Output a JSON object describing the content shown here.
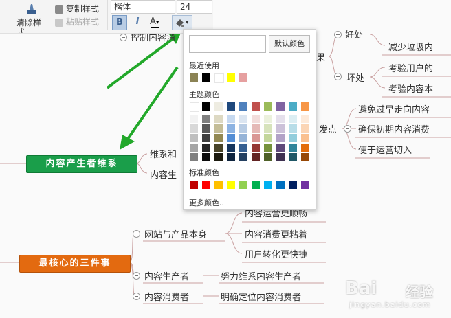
{
  "toolbar": {
    "clear_style": "清除样式",
    "copy_style": "复制样式",
    "paste_style": "粘贴样式",
    "font_family": "楷体",
    "font_size": "24",
    "bold": "B",
    "italic": "I",
    "font_color": "A",
    "dropdown_arrow": "▾"
  },
  "mindmap": {
    "truncated_top": "控制内容消",
    "pros_cons_label": "果",
    "benefit": "好处",
    "benefit_item": "减少垃圾内",
    "drawback": "坏处",
    "drawback_item1": "考验用户的",
    "drawback_item2": "考验内容本",
    "starting_point": "发点",
    "sp_item1": "避免过早走向内容",
    "sp_item2": "确保初期内容消费",
    "sp_item3": "便于运营切入",
    "main_node1": "内容产生者维系",
    "sub1": "维系和",
    "sub2": "内容生",
    "main_node2": "最核心的三件事",
    "website_product": "网站与产品本身",
    "wp_item1": "内容运营更顺畅",
    "wp_item2": "内容消费更粘着",
    "wp_item3": "用户转化更快捷",
    "producer": "内容生产者",
    "producer_item": "努力维系内容生产者",
    "consumer": "内容消费者",
    "consumer_item": "明确定位内容消费者"
  },
  "color_picker": {
    "default_button": "默认颜色",
    "recent_label": "最近使用",
    "theme_label": "主题颜色",
    "standard_label": "标准颜色",
    "more_colors": "更多颜色..",
    "recent_colors": [
      "#8b8355",
      "#000000",
      "#ffffff",
      "#ffff00",
      "#e6a0a0"
    ],
    "theme_top": [
      "#ffffff",
      "#000000",
      "#eeece1",
      "#1f497d",
      "#4f81bd",
      "#c0504d",
      "#9bbb59",
      "#8064a2",
      "#4bacc6",
      "#f79646"
    ],
    "theme_shades": [
      [
        "#f2f2f2",
        "#7f7f7f",
        "#ddd9c3",
        "#c6d9f0",
        "#dbe5f1",
        "#f2dcdb",
        "#ebf1dd",
        "#e5e0ec",
        "#dbeef3",
        "#fdeada"
      ],
      [
        "#d8d8d8",
        "#595959",
        "#c4bd97",
        "#8db3e2",
        "#b8cce4",
        "#e5b9b7",
        "#d7e3bc",
        "#ccc1d9",
        "#b7dde8",
        "#fbd5b5"
      ],
      [
        "#bfbfbf",
        "#3f3f3f",
        "#938953",
        "#548dd4",
        "#95b3d7",
        "#d99694",
        "#c3d69b",
        "#b2a2c7",
        "#92cddc",
        "#fac08f"
      ],
      [
        "#a5a5a5",
        "#262626",
        "#494429",
        "#17365d",
        "#366092",
        "#953734",
        "#76923c",
        "#5f497a",
        "#31859b",
        "#e36c09"
      ],
      [
        "#7f7f7f",
        "#0c0c0c",
        "#1d1b10",
        "#0f243e",
        "#244061",
        "#632423",
        "#4f6128",
        "#3f3151",
        "#205867",
        "#974806"
      ]
    ],
    "standard_colors": [
      "#c00000",
      "#ff0000",
      "#ffc000",
      "#ffff00",
      "#92d050",
      "#00b050",
      "#00b0f0",
      "#0070c0",
      "#002060",
      "#7030a0"
    ]
  },
  "colors": {
    "main_node1_bg": "#1a9e4a",
    "main_node2_bg": "#e36a10",
    "arrow_green": "#22a82a",
    "branch_line": "#c9a0a0"
  },
  "watermark": {
    "brand": "Bai",
    "brand2": "经验",
    "url": "jingyan.baidu.com"
  }
}
